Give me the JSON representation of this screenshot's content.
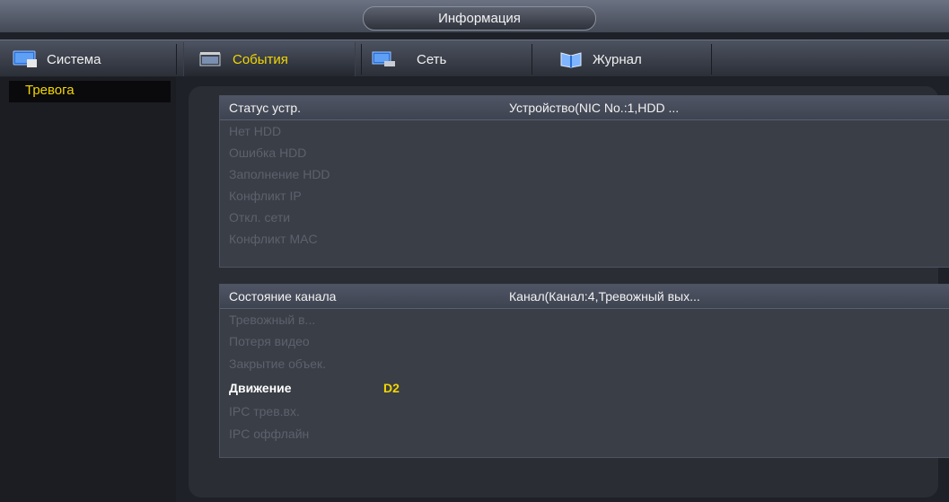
{
  "window": {
    "title": "Информация"
  },
  "tabs": [
    {
      "label": "Система",
      "icon": "monitor-icon"
    },
    {
      "label": "События",
      "icon": "events-icon"
    },
    {
      "label": "Сеть",
      "icon": "network-icon"
    },
    {
      "label": "Журнал",
      "icon": "log-book-icon"
    }
  ],
  "active_tab": "События",
  "sidebar": {
    "items": [
      {
        "label": "Тревога"
      }
    ]
  },
  "device_status": {
    "header_col1": "Статус устр.",
    "header_col2": "Устройство(NIC No.:1,HDD ...",
    "rows": [
      "Нет HDD",
      "Ошибка HDD",
      "Заполнение HDD",
      "Конфликт IP",
      "Откл. сети",
      "Конфликт MAC"
    ]
  },
  "channel_status": {
    "header_col1": "Состояние канала",
    "header_col2": "Канал(Канал:4,Тревожный вых...",
    "rows": [
      {
        "label": "Тревожный в...",
        "value": ""
      },
      {
        "label": "Потеря видео",
        "value": ""
      },
      {
        "label": "Закрытие объек.",
        "value": ""
      },
      {
        "label": "Движение",
        "value": "D2"
      },
      {
        "label": "IPC трев.вх.",
        "value": ""
      },
      {
        "label": "IPC оффлайн",
        "value": ""
      }
    ]
  },
  "colors": {
    "accent": "#f3d600",
    "inactive_text": "#5c616c"
  }
}
